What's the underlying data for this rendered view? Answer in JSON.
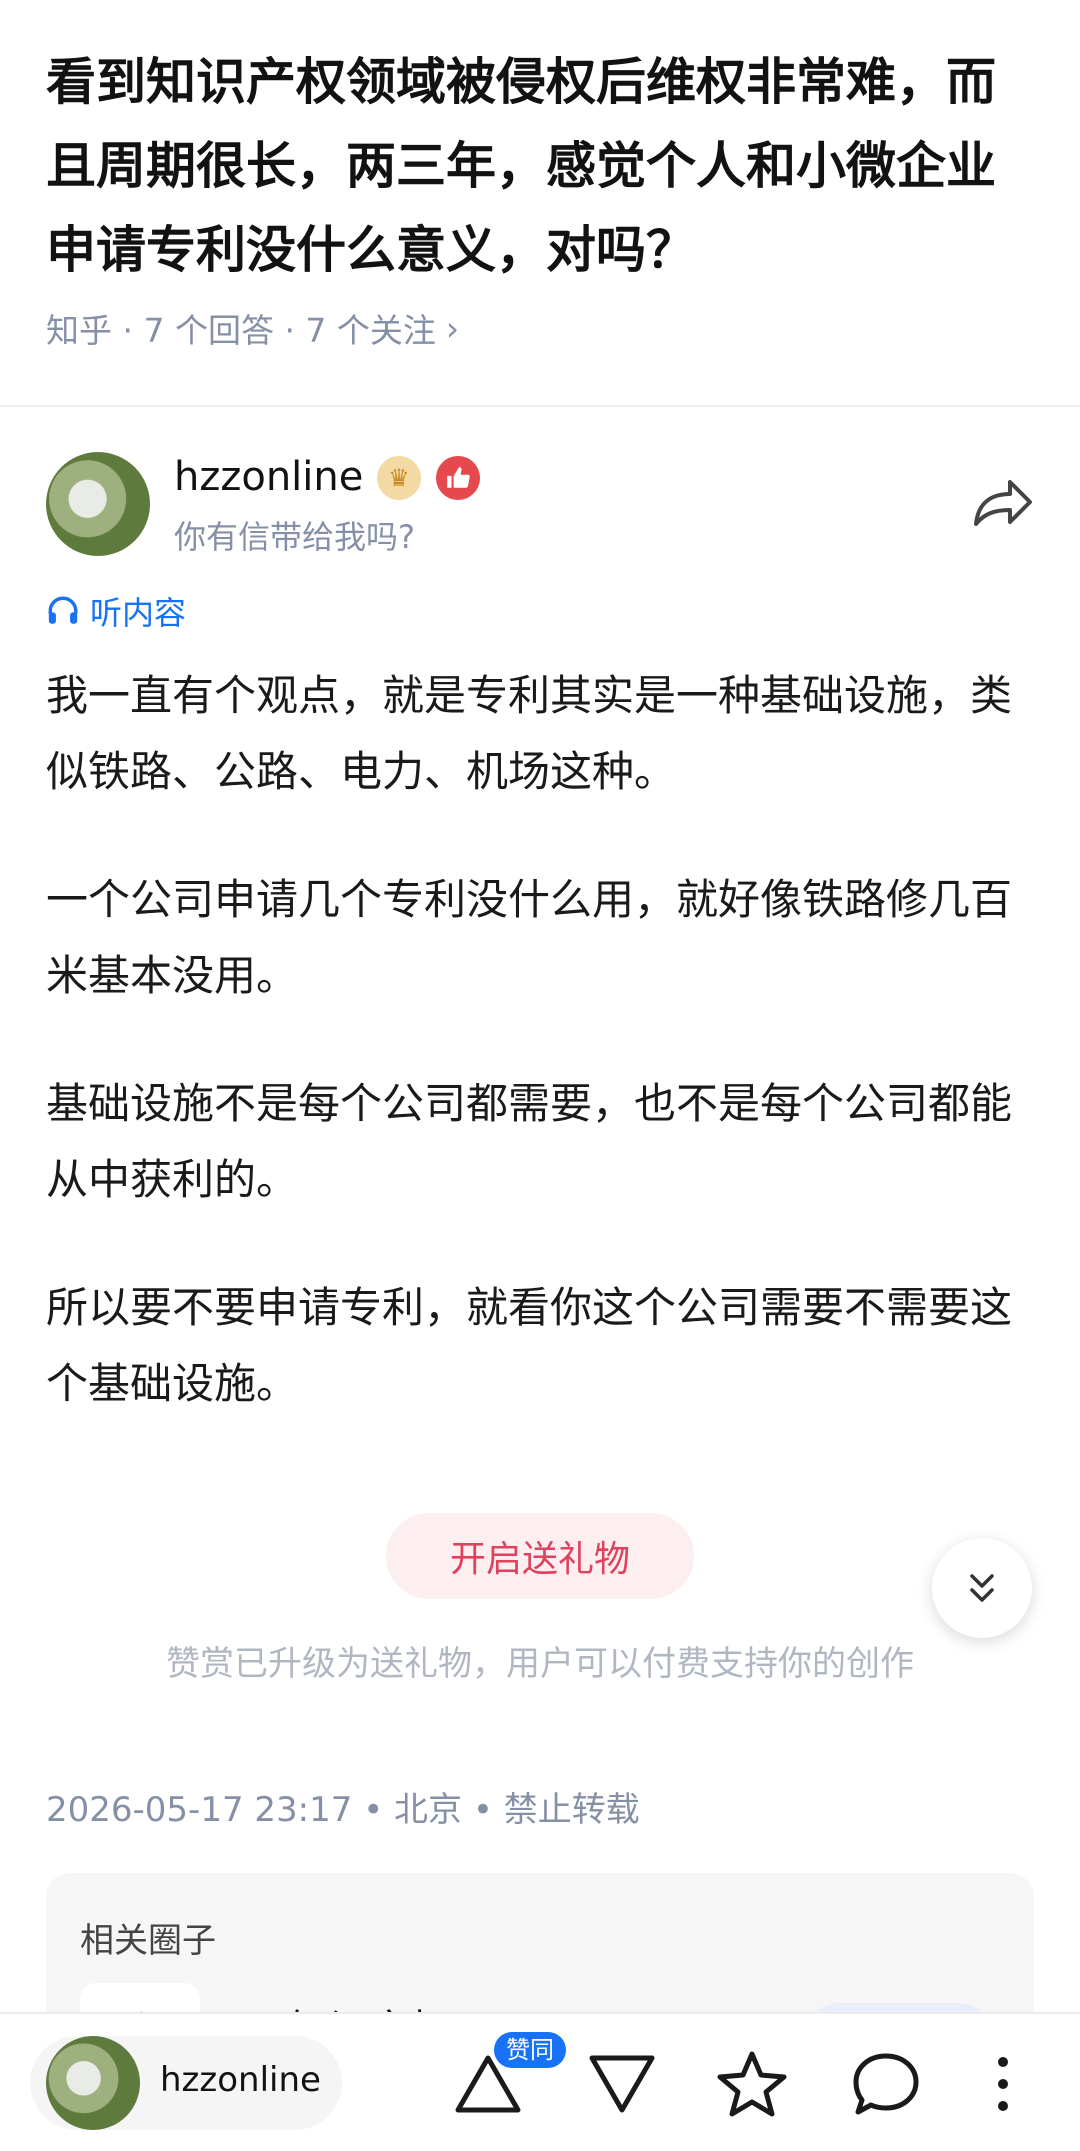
{
  "question": {
    "title": "看到知识产权领域被侵权后维权非常难，而且周期很长，两三年，感觉个人和小微企业申请专利没什么意义，对吗？",
    "meta": "知乎 · 7 个回答 · 7 个关注",
    "chevron": "›"
  },
  "author": {
    "name": "hzzonline",
    "bio": "你有信带给我吗?",
    "crown_icon": "♛"
  },
  "listen": {
    "label": "听内容"
  },
  "answer": {
    "paragraphs": [
      "我一直有个观点，就是专利其实是一种基础设施，类似铁路、公路、电力、机场这种。",
      "一个公司申请几个专利没什么用，就好像铁路修几百米基本没用。",
      "基础设施不是每个公司都需要，也不是每个公司都能从中获利的。",
      "所以要不要申请专利，就看你这个公司需要不需要这个基础设施。"
    ]
  },
  "gift": {
    "button_label": "开启送礼物",
    "note": "赞赏已升级为送礼物，用户可以付费支持你的创作"
  },
  "post_meta": "2026-05-17 23:17 • 北京 • 禁止转载",
  "related": {
    "title": "相关圈子",
    "circle_name": "◎ 知识产权"
  },
  "bottom_bar": {
    "author_name": "hzzonline",
    "upvote_tag": "赞同"
  },
  "colors": {
    "accent": "#1772f6",
    "gift": "#e0425e",
    "meta": "#8590a6"
  }
}
